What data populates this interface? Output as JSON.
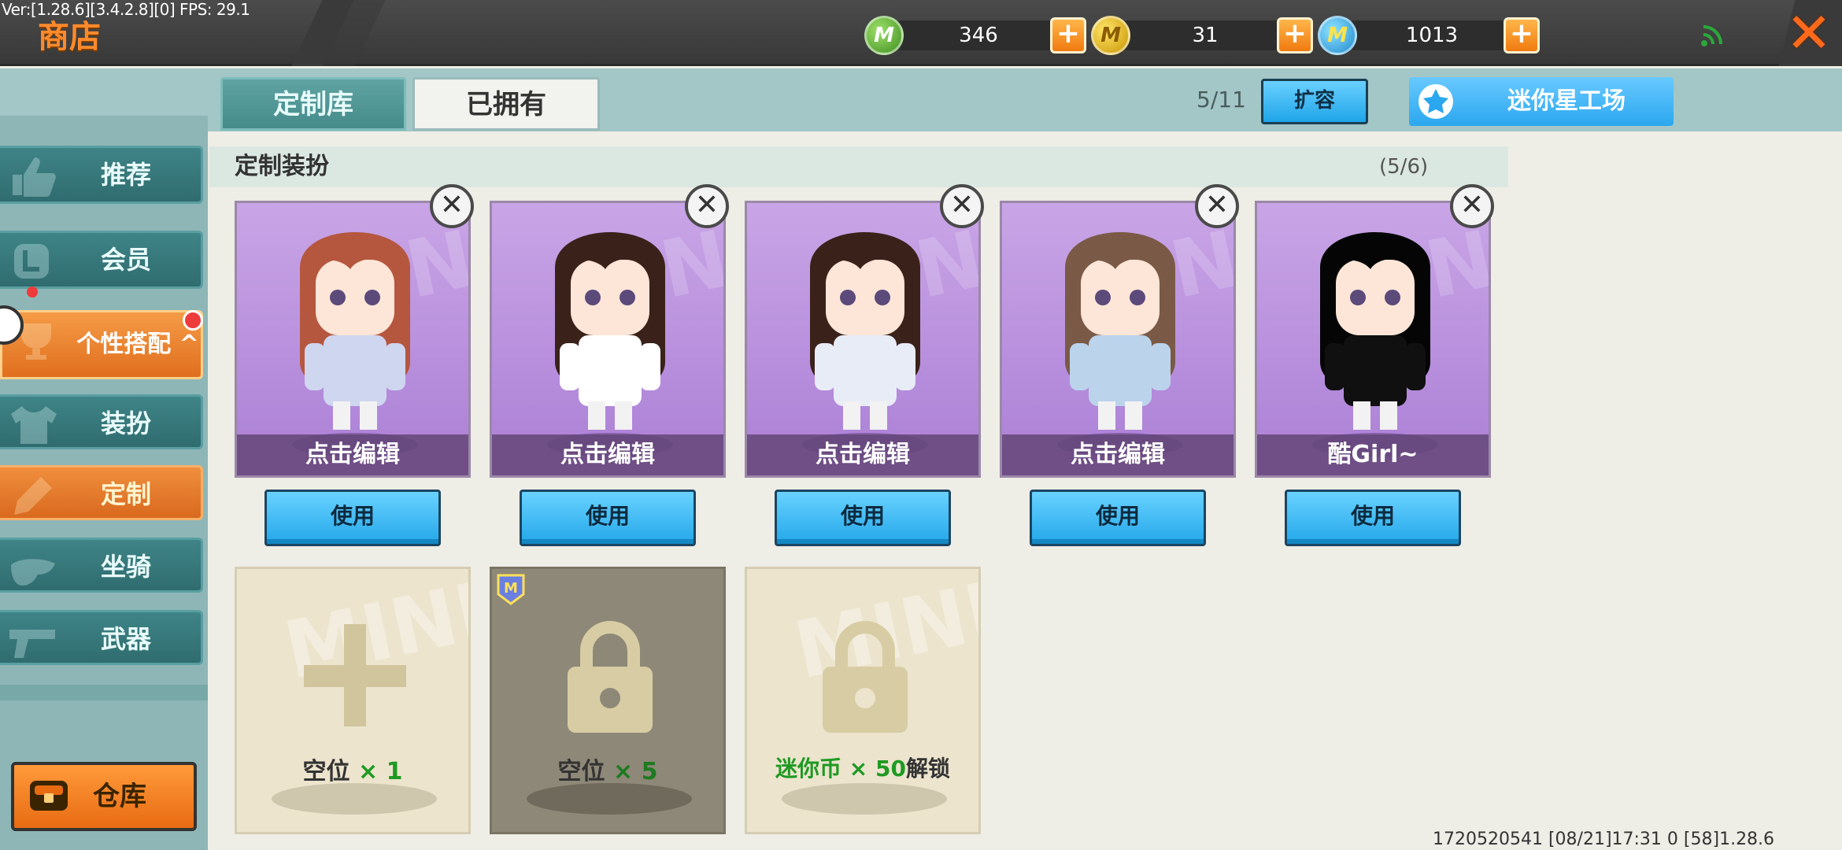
{
  "debug": {
    "version": "Ver:[1.28.6][3.4.2.8][0] FPS: 29.1"
  },
  "header": {
    "title": "商店",
    "currencies": [
      {
        "name": "mini-bean",
        "amount": "346",
        "color": "#4fae2f",
        "icon": "green-m-coin-icon"
      },
      {
        "name": "mini-gold",
        "amount": "31",
        "color": "#e8b800",
        "icon": "gold-m-coin-icon"
      },
      {
        "name": "mini-coin",
        "amount": "1013",
        "color": "#2a9de0",
        "icon": "blue-m-coin-icon"
      }
    ],
    "plus_label": "+",
    "close_label": "✕"
  },
  "sidebar": {
    "items": [
      {
        "label": "推荐",
        "icon": "thumbs-up-icon"
      },
      {
        "label": "会员",
        "icon": "vip-badge-icon"
      },
      {
        "label": "个性搭配 ^",
        "icon": "trophy-icon"
      },
      {
        "label": "装扮",
        "icon": "shirt-icon"
      },
      {
        "label": "定制",
        "icon": "pencil-icon"
      },
      {
        "label": "坐骑",
        "icon": "saddle-icon"
      },
      {
        "label": "武器",
        "icon": "gun-icon"
      }
    ],
    "warehouse_label": "仓库"
  },
  "tabs": [
    {
      "label": "定制库",
      "active": false
    },
    {
      "label": "已拥有",
      "active": true
    }
  ],
  "toolbar": {
    "capacity": "5/11",
    "expand_label": "扩容",
    "workshop_label": "迷你星工场"
  },
  "section": {
    "title": "定制装扮",
    "count": "(5/6)"
  },
  "outfits": [
    {
      "name": "点击编辑",
      "use_label": "使用",
      "hair": "#b5573e",
      "outfit": "#cfd6ef"
    },
    {
      "name": "点击编辑",
      "use_label": "使用",
      "hair": "#3a221a",
      "outfit": "#ffffff"
    },
    {
      "name": "点击编辑",
      "use_label": "使用",
      "hair": "#3a221a",
      "outfit": "#e8ecf7"
    },
    {
      "name": "点击编辑",
      "use_label": "使用",
      "hair": "#7a5a46",
      "outfit": "#bcd3ec"
    },
    {
      "name": "酷Girl~",
      "use_label": "使用",
      "hair": "#050505",
      "outfit": "#101010"
    }
  ],
  "slots": [
    {
      "prefix": "空位 ",
      "highlight": "× 1",
      "suffix": "",
      "icon": "plus-icon"
    },
    {
      "prefix": "空位 ",
      "highlight": "× 5",
      "suffix": "",
      "icon": "lock-icon"
    },
    {
      "prefix": "",
      "highlight": "迷你币 × 50",
      "suffix": "解锁",
      "icon": "lock-icon"
    }
  ],
  "footer": {
    "info": "1720520541   [08/21]17:31 0    [58]1.28.6"
  }
}
